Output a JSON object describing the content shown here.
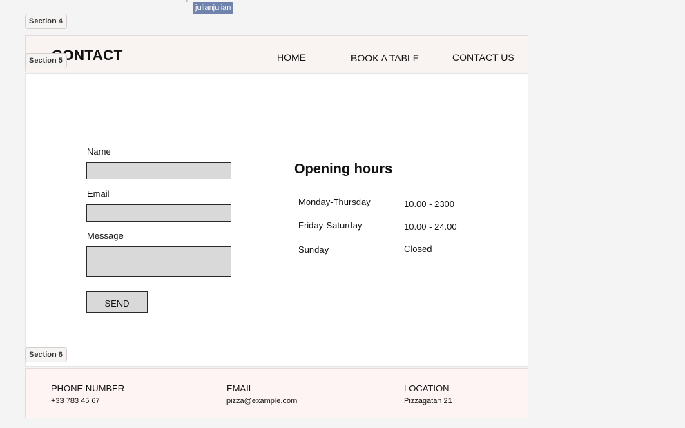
{
  "canvas": {
    "section_labels": [
      "Section 4",
      "Section 5",
      "Section 6"
    ],
    "cursor_user": "julianjulian"
  },
  "header": {
    "brand": "CONTACT",
    "nav": [
      "HOME",
      "BOOK A TABLE",
      "CONTACT US"
    ]
  },
  "form": {
    "name_label": "Name",
    "email_label": "Email",
    "message_label": "Message",
    "send_label": "SEND"
  },
  "hours": {
    "title": "Opening hours",
    "rows": [
      {
        "day": "Monday-Thursday",
        "time": "10.00 - 2300"
      },
      {
        "day": "Friday-Saturday",
        "time": "10.00 - 24.00"
      },
      {
        "day": "Sunday",
        "time": "Closed"
      }
    ]
  },
  "footer": {
    "phone_label": "PHONE NUMBER",
    "phone_value": "+33 783 45 67",
    "email_label": "EMAIL",
    "email_value": "pizza@example.com",
    "location_label": "LOCATION",
    "location_value": "Pizzagatan 21"
  },
  "colors": {
    "canvas_bg": "#f4f4f4",
    "header_bg": "#f9f3f2",
    "footer_bg": "#fdf4f3",
    "field_bg": "#d9d9d9",
    "cursor_tag": "#7083ad"
  }
}
